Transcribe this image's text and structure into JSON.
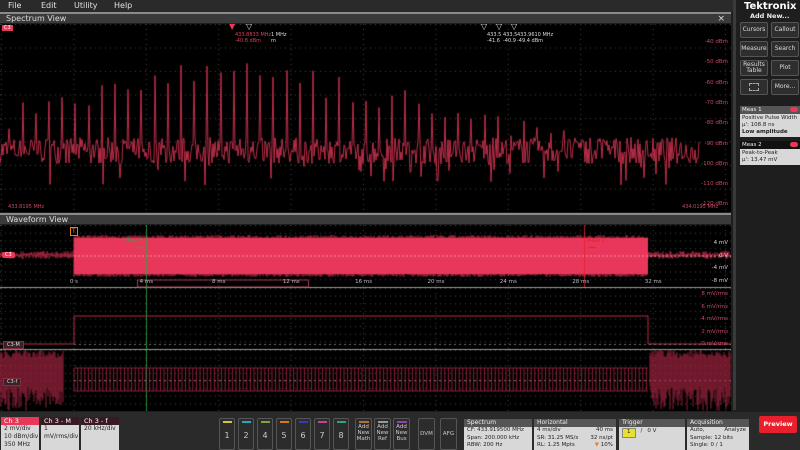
{
  "menu": [
    "File",
    "Edit",
    "Utility",
    "Help"
  ],
  "brand": "Tektronix",
  "spectrum": {
    "title": "Spectrum View",
    "close": "×",
    "ch_label": "C3",
    "y_labels": [
      "-40 dBm",
      "-50 dBm",
      "-60 dBm",
      "-70 dBm",
      "-80 dBm",
      "-90 dBm",
      "-100 dBm",
      "-110 dBm",
      "-120 dBm"
    ],
    "start_freq": "433.8195 MHz",
    "stop_freq": "434.0195 MHz",
    "markers": [
      {
        "freq": "433.8833 MHz",
        "level": "-40.8 dBm",
        "ref": true
      },
      {
        "freq": "1 MHz",
        "level": "m"
      },
      {
        "freq": "433.5",
        "level": "-41.6"
      },
      {
        "freq": "433.5",
        "level": "-40.9"
      },
      {
        "freq": "433.9610 MHz",
        "level": "-49.4 dBm"
      }
    ]
  },
  "waveform": {
    "title": "Waveform View",
    "ch3_label": "C3",
    "ch3m_label": "C3-M",
    "ch3f_label": "C3-f",
    "trigger_marker": "T",
    "cursor1": "Meas 2",
    "cursor2": "Meas 2",
    "time_labels": [
      "0 s",
      "4 ms",
      "8 ms",
      "12 ms",
      "16 ms",
      "20 ms",
      "24 ms",
      "28 ms",
      "32 ms"
    ],
    "ch3_y_labels": [
      "4 mV",
      "0 V",
      "-4 mV",
      "-8 mV"
    ],
    "ch3m_y_labels": [
      "8 mV/rms",
      "6 mV/rms",
      "4 mV/rms",
      "2 mV/rms",
      "0 mV/rms"
    ]
  },
  "right_panel": {
    "add_new": "Add New...",
    "buttons": [
      "Cursors",
      "Callout",
      "Measure",
      "Search",
      "Results Table",
      "Plot",
      "",
      "More..."
    ],
    "meas1": {
      "title": "Meas 1",
      "name": "Positive Pulse Width",
      "value": "µ': 108.8 ns",
      "note": "Low amplitude"
    },
    "meas2": {
      "title": "Meas 2",
      "name": "Peak-to-Peak",
      "value": "µ': 13.47 mV"
    }
  },
  "bottom": {
    "ch3": {
      "title": "Ch 3",
      "lines": [
        "2 mV/div",
        "10 dBm/div",
        "350 MHz"
      ]
    },
    "ch3m": {
      "title": "Ch 3 - M",
      "lines": [
        "1 mV/rms/div"
      ]
    },
    "ch3f": {
      "title": "Ch 3 - f",
      "lines": [
        "20 kHz/div"
      ]
    },
    "channels": [
      {
        "n": "1",
        "c": "#c8c838"
      },
      {
        "n": "2",
        "c": "#28a8b8"
      },
      {
        "n": "4",
        "c": "#78a838"
      },
      {
        "n": "5",
        "c": "#d07828"
      },
      {
        "n": "6",
        "c": "#3838c8"
      },
      {
        "n": "7",
        "c": "#c04888"
      },
      {
        "n": "8",
        "c": "#28a878"
      }
    ],
    "add_math": "Add New Math",
    "add_ref": "Add New Ref",
    "add_bus": "Add New Bus",
    "dvm": "DVM",
    "afg": "AFG",
    "spectrum": {
      "title": "Spectrum",
      "cf": "CF: 433.919500 MHz",
      "span": "Span: 200.000 kHz",
      "rbw": "RBW: 200 Hz"
    },
    "horizontal": {
      "title": "Horizontal",
      "scale": "4 ms/div",
      "dur": "40 ms",
      "sr": "SR: 31.25 MS/s",
      "pt": "32 ns/pt",
      "rl": "RL: 1.25 Mpts",
      "pos": "10%"
    },
    "trigger": {
      "title": "Trigger",
      "src": "1",
      "level": "0 V"
    },
    "acquisition": {
      "title": "Acquisition",
      "mode": "Auto,",
      "analyze": "Analyze",
      "sample": "Sample: 12 bits",
      "single": "Single: 0 / 1"
    },
    "preview": "Preview"
  },
  "colors": {
    "trace": "#e8385a",
    "dark_trace": "#b02848",
    "accent": "#e8202c"
  }
}
